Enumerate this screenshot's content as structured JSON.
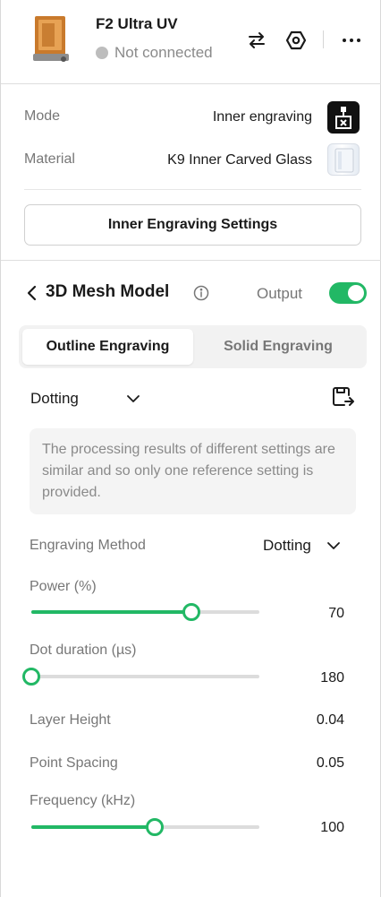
{
  "device": {
    "name": "F2 Ultra UV",
    "status": "Not connected",
    "icons": [
      "laser-device-image",
      "swap-icon",
      "settings-hex-icon",
      "more-icon"
    ]
  },
  "mode": {
    "mode_label": "Mode",
    "mode_value": "Inner engraving",
    "material_label": "Material",
    "material_value": "K9 Inner Carved Glass",
    "settings_button": "Inner Engraving Settings"
  },
  "section": {
    "title": "3D Mesh Model",
    "output_label": "Output",
    "output_enabled": true
  },
  "tabs": [
    {
      "label": "Outline Engraving",
      "active": true
    },
    {
      "label": "Solid Engraving",
      "active": false
    }
  ],
  "preset": {
    "selected": "Dotting"
  },
  "notice": "The processing results of different settings are similar and so only one reference setting is provided.",
  "params": {
    "method": {
      "label": "Engraving Method",
      "value": "Dotting"
    },
    "power": {
      "label": "Power (%)",
      "value": "70",
      "level": 0.7
    },
    "dot_duration": {
      "label": "Dot duration (µs)",
      "value": "180",
      "level": 0.0
    },
    "layer_height": {
      "label": "Layer Height",
      "value": "0.04"
    },
    "point_spacing": {
      "label": "Point Spacing",
      "value": "0.05"
    },
    "frequency": {
      "label": "Frequency (kHz)",
      "value": "100",
      "level": 0.54
    }
  },
  "colors": {
    "accent": "#22b865",
    "muted_text": "#777777",
    "track": "#dcdcdc"
  }
}
